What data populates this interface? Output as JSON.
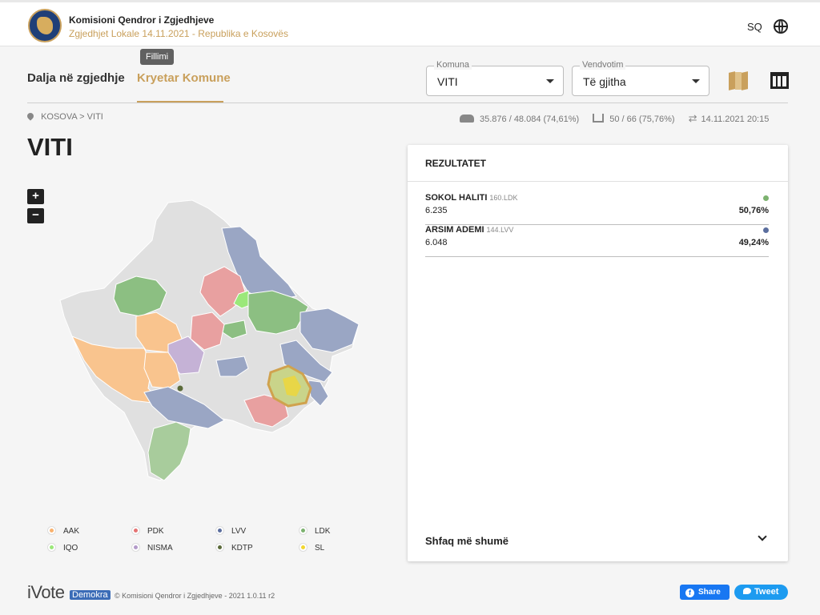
{
  "header": {
    "org_name": "Komisioni Qendror i Zgjedhjeve",
    "subtitle": "Zgjedhjet Lokale 14.11.2021 - Republika e Kosovës",
    "language": "SQ"
  },
  "nav": {
    "tabs": [
      {
        "label": "Dalja në zgjedhje"
      },
      {
        "label": "Kryetar Komune"
      }
    ],
    "tooltip": "Fillimi"
  },
  "filters": {
    "komuna": {
      "label": "Komuna",
      "value": "VITI"
    },
    "vendvotim": {
      "label": "Vendvotim",
      "value": "Të gjitha"
    }
  },
  "breadcrumb": {
    "country": "KOSOVA",
    "separator": ">",
    "municipality": "VITI"
  },
  "stats": {
    "voters": "35.876 / 48.084 (74,61%)",
    "stations": "50 / 66 (75,76%)",
    "updated": "14.11.2021 20:15"
  },
  "municipality_title": "VITI",
  "zoom": {
    "in": "+",
    "out": "−"
  },
  "legend": [
    {
      "label": "AAK",
      "color": "#f9b26e"
    },
    {
      "label": "PDK",
      "color": "#e57373"
    },
    {
      "label": "LVV",
      "color": "#5b6e9e"
    },
    {
      "label": "LDK",
      "color": "#7cb26f"
    },
    {
      "label": "IQO",
      "color": "#9be87a"
    },
    {
      "label": "NISMA",
      "color": "#b39ac9"
    },
    {
      "label": "KDTP",
      "color": "#5b6b3a"
    },
    {
      "label": "SL",
      "color": "#f2d730"
    }
  ],
  "results": {
    "title": "REZULTATET",
    "candidates": [
      {
        "name": "SOKOL HALITI",
        "party": "160.LDK",
        "votes": "6.235",
        "percent": "50,76%",
        "color": "#7cb26f"
      },
      {
        "name": "ARSIM ADEMI",
        "party": "144.LVV",
        "votes": "6.048",
        "percent": "49,24%",
        "color": "#5b6e9e"
      }
    ],
    "show_more": "Shfaq më shumë"
  },
  "footer": {
    "brand": "iVote",
    "brand_tag": "Demokra",
    "copyright": "© Komisioni Qendror i Zgjedhjeve - 2021 1.0.11 r2",
    "share_label": "Share",
    "tweet_label": "Tweet"
  }
}
